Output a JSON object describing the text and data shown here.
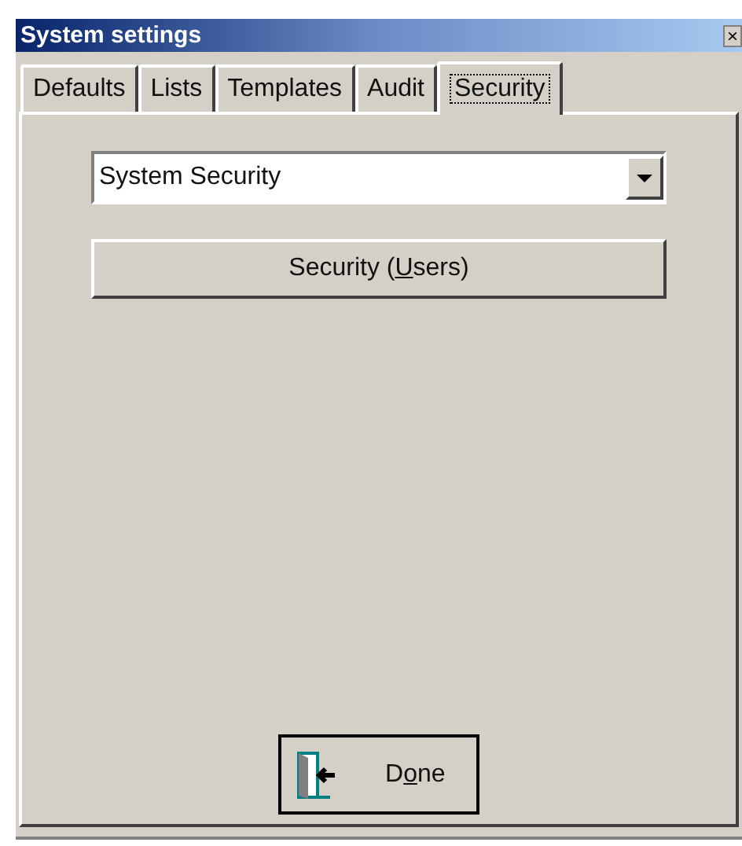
{
  "window": {
    "title": "System settings",
    "close": "×"
  },
  "tabs": [
    {
      "label": "Defaults",
      "selected": false
    },
    {
      "label": "Lists",
      "selected": false
    },
    {
      "label": "Templates",
      "selected": false
    },
    {
      "label": "Audit",
      "selected": false
    },
    {
      "label": "Security",
      "selected": true
    }
  ],
  "dropdown": {
    "value": "System Security"
  },
  "security_button": {
    "before": "Security (",
    "mnemonic": "U",
    "after": "sers)"
  },
  "done_button": {
    "before": "D",
    "mnemonic": "o",
    "after": "ne"
  }
}
